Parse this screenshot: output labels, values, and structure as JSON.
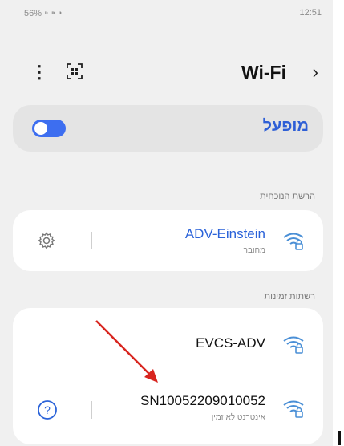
{
  "status_bar": {
    "left": "56% ⁍ ⁍ ⁍",
    "time": "12:51"
  },
  "toolbar": {
    "more_glyph": "⋮",
    "title": "Wi-Fi",
    "chevron": "›"
  },
  "wifi_toggle": {
    "label": "מופעל",
    "on": true,
    "color": "#3d6ef0"
  },
  "current_network": {
    "section_label": "הרשת הנוכחית",
    "name": "ADV-Einstein",
    "status": "מחובר"
  },
  "available_networks": {
    "section_label": "רשתות זמינות",
    "items": [
      {
        "name": "EVCS-ADV",
        "status": ""
      },
      {
        "name": "SN10052209010052",
        "status": "אינטרנט לא זמין"
      }
    ]
  },
  "icons": [
    "more-icon",
    "scan-qr-icon",
    "chevron-right-icon",
    "gear-icon",
    "wifi-lock-icon",
    "help-icon",
    "red-arrow-annotation"
  ],
  "colors": {
    "accent": "#2e5fd6",
    "annotation": "#d8251f"
  }
}
